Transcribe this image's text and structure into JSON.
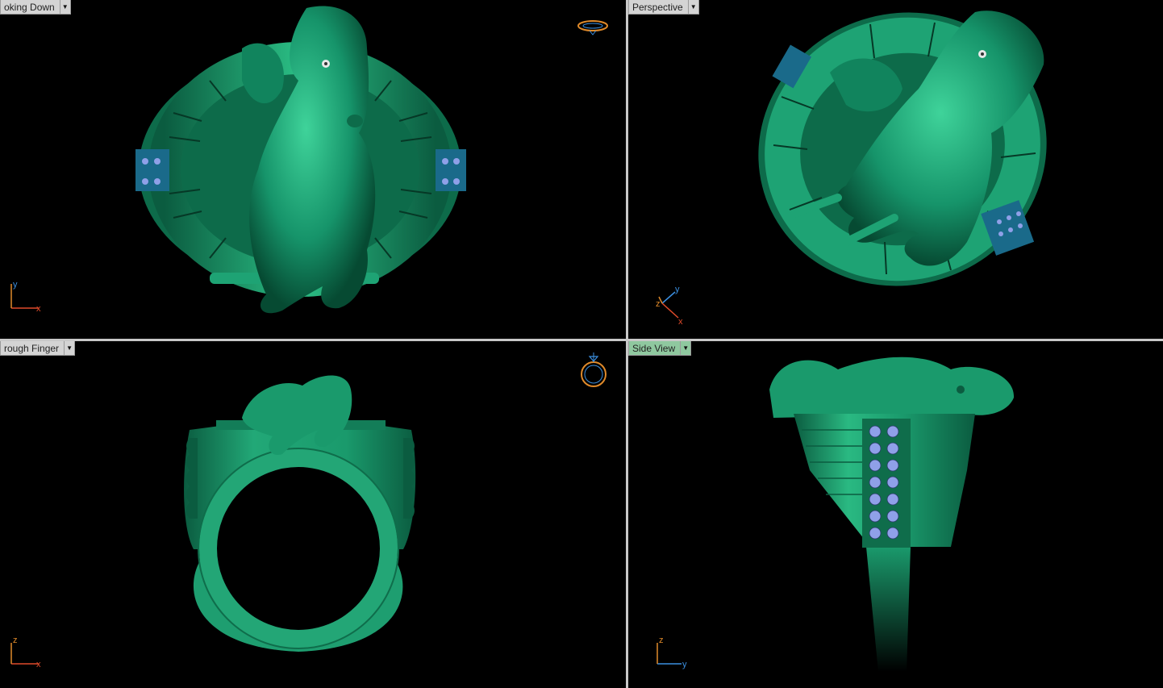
{
  "viewports": {
    "top_left": {
      "label": "oking Down",
      "axes": [
        "y",
        "x"
      ]
    },
    "top_right": {
      "label": "Perspective",
      "axes": [
        "z",
        "y",
        "x"
      ]
    },
    "bottom_left": {
      "label": "rough Finger",
      "axes": [
        "z",
        "x"
      ]
    },
    "bottom_right": {
      "label": "Side View",
      "axes": [
        "z",
        "y"
      ]
    }
  },
  "colors": {
    "model_green": "#16946a",
    "model_dark": "#0b5c40",
    "model_light": "#3fd39a",
    "gem_blue": "#8fa0e8",
    "axis_x": "#e04b2a",
    "axis_y": "#3b8fe0",
    "axis_z": "#e08a2a",
    "active_tab": "#8fc89f",
    "divider": "#c8c8c8"
  },
  "icons": [
    "dropdown-arrow-icon",
    "ring-orientation-icon",
    "axis-triad-icon"
  ]
}
